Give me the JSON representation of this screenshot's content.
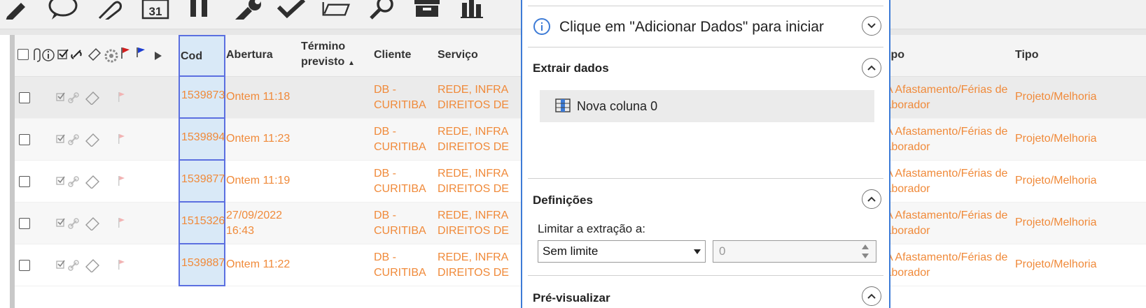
{
  "toolbar": {
    "icons": [
      "pencil-icon",
      "speech-bubble-icon",
      "paperclip-icon",
      "calendar-icon",
      "pause-icon",
      "wrench-icon",
      "checkmark-icon",
      "folder-open-icon",
      "magnifier-icon",
      "archive-box-icon",
      "bar-chart-icon"
    ],
    "calendar_day": "31"
  },
  "table": {
    "columns": {
      "cod": "Cod",
      "abertura": "Abertura",
      "termino_line1": "Término",
      "termino_line2": "previsto",
      "termino_sort": "▲",
      "cliente": "Cliente",
      "servico": "Serviço",
      "grupo": "Grupo",
      "tipo": "Tipo"
    },
    "header_icons": [
      "select-all-checkbox",
      "attachment-icon",
      "info-icon",
      "check-icon",
      "link-icon",
      "ticket-icon",
      "settings-gear-icon",
      "red-flag-icon",
      "blue-flag-icon",
      "play-arrow-icon"
    ],
    "rows": [
      {
        "cod": "1539873",
        "abertura_l1": "Ontem 11:18",
        "abertura_l2": "",
        "cliente_l1": "DB -",
        "cliente_l2": "CURITIBA",
        "servico_l1": "REDE, INFRA",
        "servico_l2": "DIREITOS DE",
        "grupo_l1": "RPA Afastamento/Férias de",
        "grupo_l2": "colaborador",
        "tipo": "Projeto/Melhoria"
      },
      {
        "cod": "1539894",
        "abertura_l1": "Ontem 11:23",
        "abertura_l2": "",
        "cliente_l1": "DB -",
        "cliente_l2": "CURITIBA",
        "servico_l1": "REDE, INFRA",
        "servico_l2": "DIREITOS DE",
        "grupo_l1": "RPA Afastamento/Férias de",
        "grupo_l2": "colaborador",
        "tipo": "Projeto/Melhoria"
      },
      {
        "cod": "1539877",
        "abertura_l1": "Ontem 11:19",
        "abertura_l2": "",
        "cliente_l1": "DB -",
        "cliente_l2": "CURITIBA",
        "servico_l1": "REDE, INFRA",
        "servico_l2": "DIREITOS DE",
        "grupo_l1": "RPA Afastamento/Férias de",
        "grupo_l2": "colaborador",
        "tipo": "Projeto/Melhoria"
      },
      {
        "cod": "1515326",
        "abertura_l1": "27/09/2022",
        "abertura_l2": "16:43",
        "cliente_l1": "DB -",
        "cliente_l2": "CURITIBA",
        "servico_l1": "REDE, INFRA",
        "servico_l2": "DIREITOS DE",
        "grupo_l1": "RPA Afastamento/Férias de",
        "grupo_l2": "colaborador",
        "tipo": "Projeto/Melhoria"
      },
      {
        "cod": "1539887",
        "abertura_l1": "Ontem 11:22",
        "abertura_l2": "",
        "cliente_l1": "DB -",
        "cliente_l2": "CURITIBA",
        "servico_l1": "REDE, INFRA",
        "servico_l2": "DIREITOS DE",
        "grupo_l1": "RPA Afastamento/Férias de",
        "grupo_l2": "colaborador",
        "tipo": "Projeto/Melhoria"
      }
    ]
  },
  "panel": {
    "hint": "Clique em \"Adicionar Dados\" para iniciar",
    "extract_title": "Extrair dados",
    "column_label": "Nova coluna 0",
    "settings_title": "Definições",
    "limit_label": "Limitar a extração a:",
    "limit_select": "Sem limite",
    "limit_number": "0",
    "preview_title": "Pré-visualizar"
  },
  "colors": {
    "accent": "#3d7bd6",
    "row_text": "#f08a3a",
    "cod_highlight": "#d9e9f7",
    "cod_border": "#5b6fe0"
  }
}
